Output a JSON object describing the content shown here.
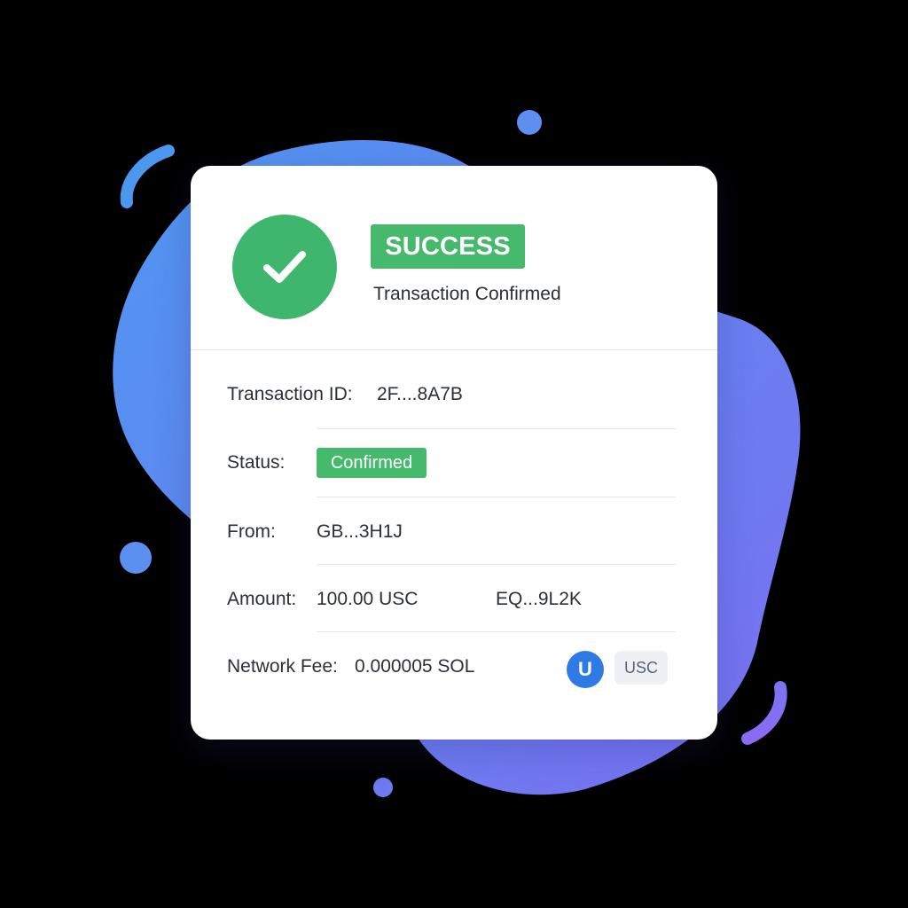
{
  "header": {
    "badge": "SUCCESS",
    "subtitle": "Transaction Confirmed",
    "icon": "check-circle-icon"
  },
  "details": {
    "transaction_id": {
      "label": "Transaction ID:",
      "value": "2F....8A7B"
    },
    "status": {
      "label": "Status:",
      "value": "Confirmed"
    },
    "from": {
      "label": "From:",
      "value": "GB...3H1J"
    },
    "amount": {
      "label": "Amount:",
      "value": "100.00 USC",
      "to": "EQ...9L2K"
    },
    "network_fee": {
      "label": "Network Fee:",
      "value": "0.000005 SOL"
    }
  },
  "token": {
    "symbol_letter": "U",
    "ticker": "USC"
  },
  "colors": {
    "success_green": "#45b96c",
    "blob_blue": "#5b92ee",
    "blob_violet": "#7a6ff0",
    "coin_blue": "#2f7be6"
  }
}
